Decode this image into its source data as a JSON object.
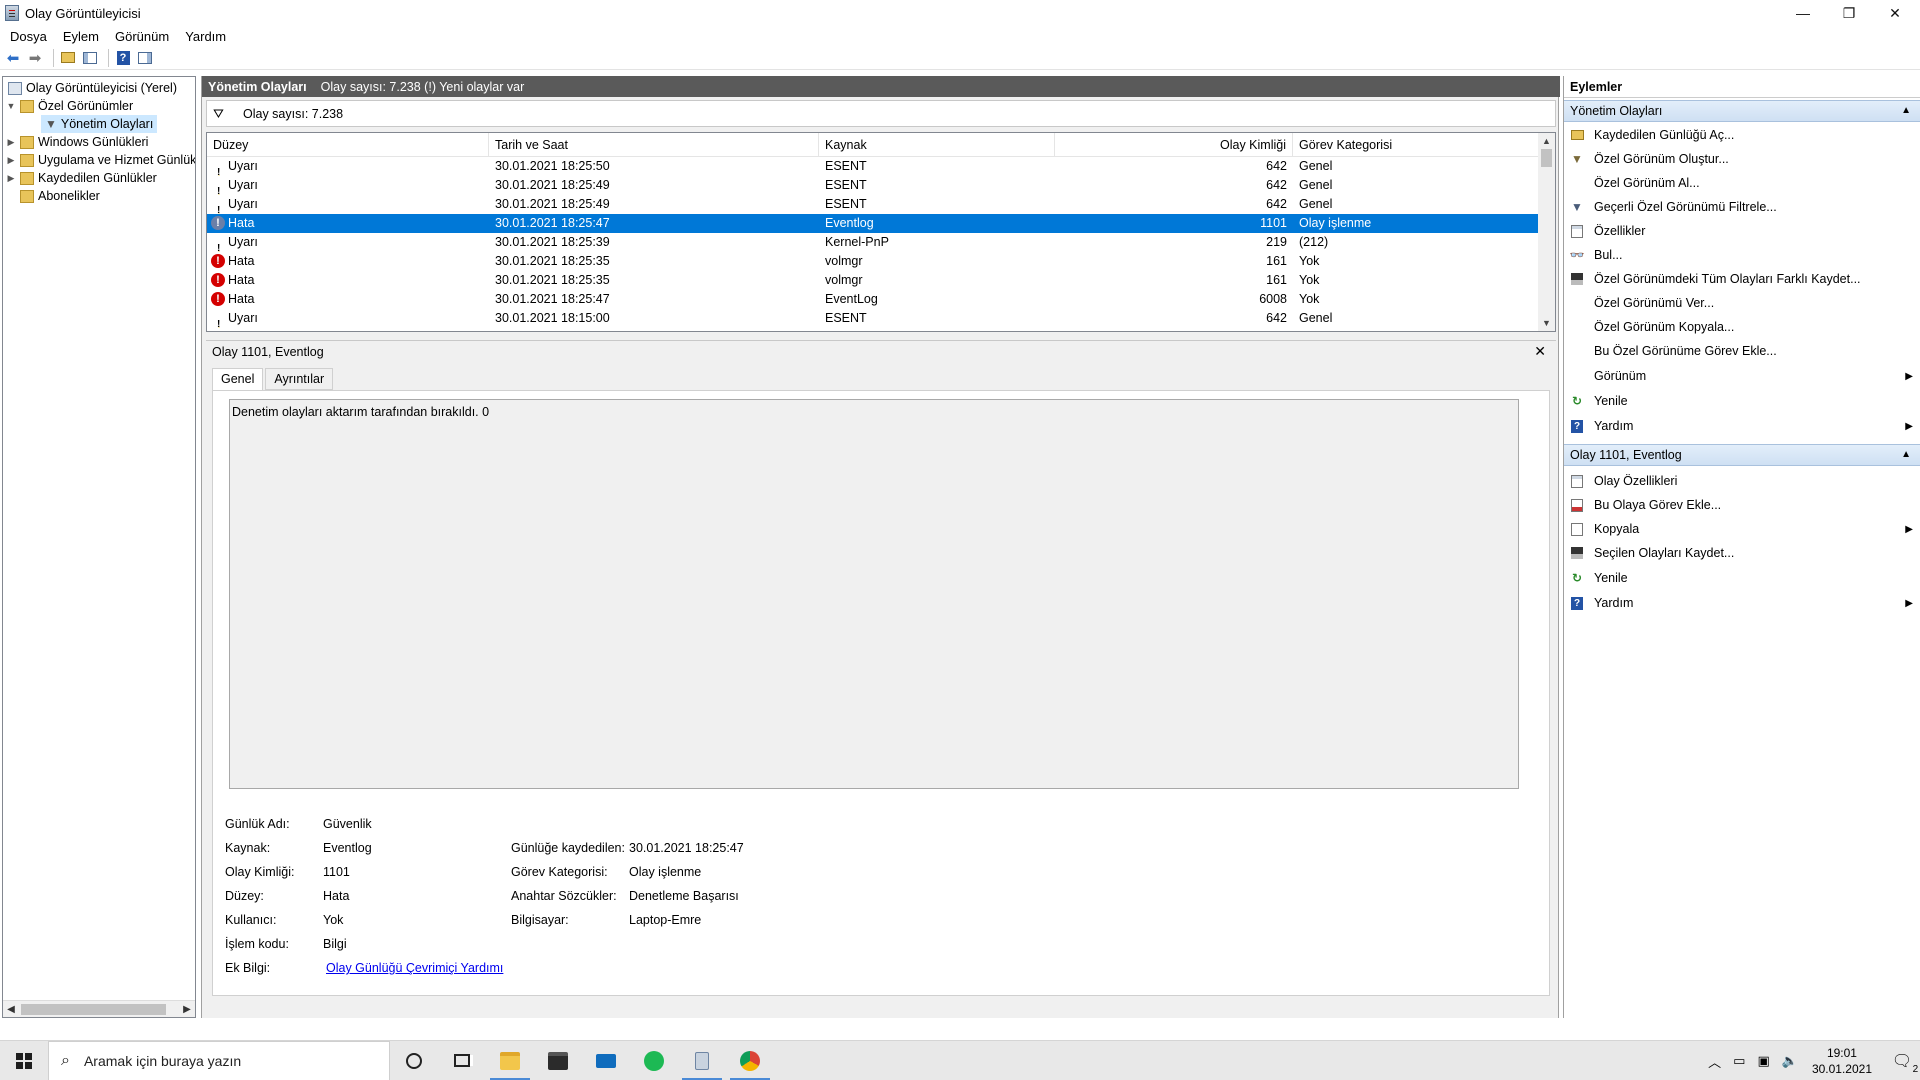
{
  "window": {
    "title": "Olay Görüntüleyicisi",
    "minimize": "—",
    "restore": "❐",
    "close": "✕"
  },
  "menu": [
    "Dosya",
    "Eylem",
    "Görünüm",
    "Yardım"
  ],
  "tree": {
    "root": "Olay Görüntüleyicisi (Yerel)",
    "custom_views": "Özel Görünümler",
    "admin_events": "Yönetim Olayları",
    "windows_logs": "Windows Günlükleri",
    "app_service_logs": "Uygulama ve Hizmet Günlük",
    "saved_logs": "Kaydedilen Günlükler",
    "subscriptions": "Abonelikler"
  },
  "center": {
    "header_title": "Yönetim Olayları",
    "header_info": "Olay sayısı: 7.238 (!) Yeni olaylar var",
    "filter_text": "Olay sayısı: 7.238",
    "columns": [
      "Düzey",
      "Tarih ve Saat",
      "Kaynak",
      "Olay Kimliği",
      "Görev Kategorisi"
    ],
    "rows": [
      {
        "level": "Uyarı",
        "type": "warn",
        "date": "30.01.2021 18:25:50",
        "source": "ESENT",
        "id": "642",
        "cat": "Genel"
      },
      {
        "level": "Uyarı",
        "type": "warn",
        "date": "30.01.2021 18:25:49",
        "source": "ESENT",
        "id": "642",
        "cat": "Genel"
      },
      {
        "level": "Uyarı",
        "type": "warn",
        "date": "30.01.2021 18:25:49",
        "source": "ESENT",
        "id": "642",
        "cat": "Genel"
      },
      {
        "level": "Hata",
        "type": "sel",
        "date": "30.01.2021 18:25:47",
        "source": "Eventlog",
        "id": "1101",
        "cat": "Olay işlenme"
      },
      {
        "level": "Uyarı",
        "type": "warn",
        "date": "30.01.2021 18:25:39",
        "source": "Kernel-PnP",
        "id": "219",
        "cat": "(212)"
      },
      {
        "level": "Hata",
        "type": "err",
        "date": "30.01.2021 18:25:35",
        "source": "volmgr",
        "id": "161",
        "cat": "Yok"
      },
      {
        "level": "Hata",
        "type": "err",
        "date": "30.01.2021 18:25:35",
        "source": "volmgr",
        "id": "161",
        "cat": "Yok"
      },
      {
        "level": "Hata",
        "type": "err",
        "date": "30.01.2021 18:25:47",
        "source": "EventLog",
        "id": "6008",
        "cat": "Yok"
      },
      {
        "level": "Uyarı",
        "type": "warn",
        "date": "30.01.2021 18:15:00",
        "source": "ESENT",
        "id": "642",
        "cat": "Genel"
      }
    ]
  },
  "detail": {
    "title": "Olay 1101, Eventlog",
    "close": "✕",
    "tab_general": "Genel",
    "tab_details": "Ayrıntılar",
    "description": "Denetim olayları aktarım tarafından bırakıldı. 0",
    "labels": {
      "log_name": "Günlük Adı:",
      "source": "Kaynak:",
      "event_id": "Olay Kimliği:",
      "level": "Düzey:",
      "user": "Kullanıcı:",
      "opcode": "İşlem kodu:",
      "more_info": "Ek Bilgi:",
      "logged": "Günlüğe kaydedilen:",
      "task_cat": "Görev Kategorisi:",
      "keywords": "Anahtar Sözcükler:",
      "computer": "Bilgisayar:"
    },
    "values": {
      "log_name": "Güvenlik",
      "source": "Eventlog",
      "event_id": "1101",
      "level": "Hata",
      "user": "Yok",
      "opcode": "Bilgi",
      "more_info": "Olay Günlüğü Çevrimiçi Yardımı",
      "logged": "30.01.2021 18:25:47",
      "task_cat": "Olay işlenme",
      "keywords": "Denetleme Başarısı",
      "computer": "Laptop-Emre"
    }
  },
  "actions": {
    "title": "Eylemler",
    "section1": "Yönetim Olayları",
    "items1": [
      "Kaydedilen Günlüğü Aç...",
      "Özel Görünüm Oluştur...",
      "Özel Görünüm Al...",
      "Geçerli Özel Görünümü Filtrele...",
      "Özellikler",
      "Bul...",
      "Özel Görünümdeki Tüm Olayları Farklı Kaydet...",
      "Özel Görünümü Ver...",
      "Özel Görünüm Kopyala...",
      "Bu Özel Görünüme Görev Ekle...",
      "Görünüm",
      "Yenile",
      "Yardım"
    ],
    "section2": "Olay 1101, Eventlog",
    "items2": [
      "Olay Özellikleri",
      "Bu Olaya Görev Ekle...",
      "Kopyala",
      "Seçilen Olayları Kaydet...",
      "Yenile",
      "Yardım"
    ]
  },
  "taskbar": {
    "search_placeholder": "Aramak için buraya yazın",
    "time": "19:01",
    "date": "30.01.2021",
    "notif_count": "2"
  }
}
